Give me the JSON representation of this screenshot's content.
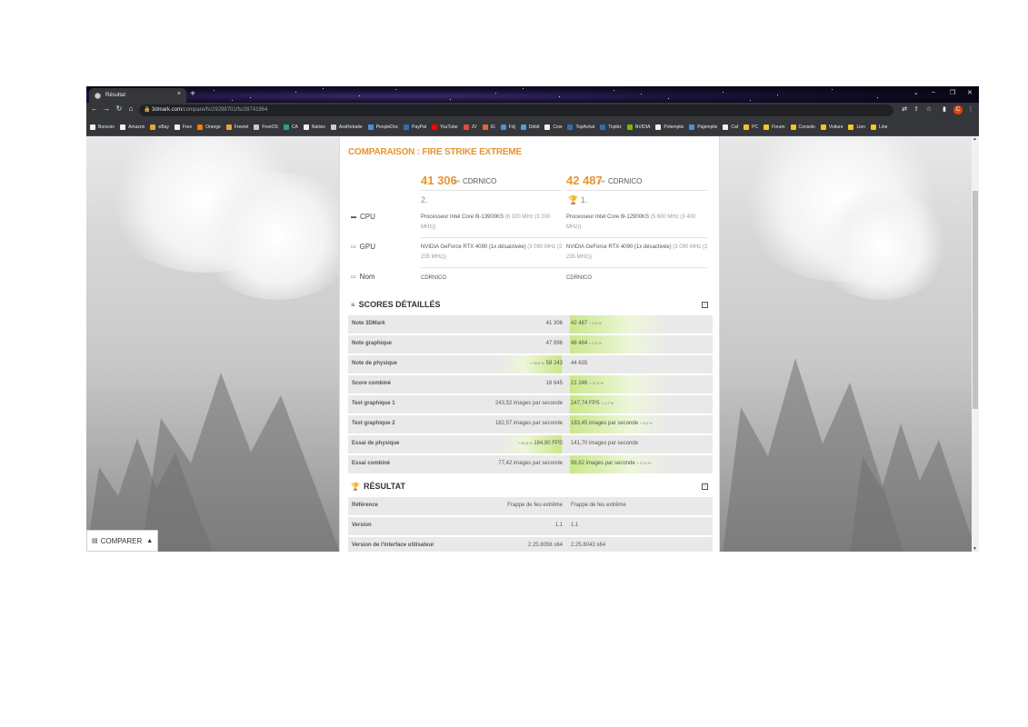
{
  "browser": {
    "tab_title": "Résultat",
    "tab_close": "×",
    "new_tab": "+",
    "url_host": "3dmark.com",
    "url_path": "/compare/fs/29298701/fs/28741964",
    "window_controls": [
      "⌄",
      "–",
      "❐",
      "✕"
    ]
  },
  "bookmarks": [
    {
      "label": "Boncoin",
      "color": "#f0f0f0"
    },
    {
      "label": "Amazon",
      "color": "#f0f0f0"
    },
    {
      "label": "eBay",
      "color": "#e8a33a"
    },
    {
      "label": "Free",
      "color": "#f0f0f0"
    },
    {
      "label": "Orange",
      "color": "#ff7900"
    },
    {
      "label": "Freetel",
      "color": "#e8a33a"
    },
    {
      "label": "FreeOS",
      "color": "#cccccc"
    },
    {
      "label": "CA",
      "color": "#2e9e8f"
    },
    {
      "label": "Natixis",
      "color": "#f0f0f0"
    },
    {
      "label": "AssRetraite",
      "color": "#cccccc"
    },
    {
      "label": "PeopleDoc",
      "color": "#4a90d9"
    },
    {
      "label": "PayPal",
      "color": "#2c6fb5"
    },
    {
      "label": "YouTube",
      "color": "#ff0000"
    },
    {
      "label": "JV",
      "color": "#e84b3c"
    },
    {
      "label": "IG",
      "color": "#e8652e"
    },
    {
      "label": "Fdj",
      "color": "#4a90d9"
    },
    {
      "label": "Débit",
      "color": "#4aa3df"
    },
    {
      "label": "Cow",
      "color": "#f0f0f0"
    },
    {
      "label": "TopAchat",
      "color": "#2c6fb5"
    },
    {
      "label": "Topbiz",
      "color": "#2c6fb5"
    },
    {
      "label": "NVIDIA",
      "color": "#76b900"
    },
    {
      "label": "Polemploi",
      "color": "#f0f0f0"
    },
    {
      "label": "Pajemploi",
      "color": "#4a90d9"
    },
    {
      "label": "Caf",
      "color": "#f0f0f0"
    },
    {
      "label": "PC",
      "color": "#f3c623"
    },
    {
      "label": "Forum",
      "color": "#f3c623"
    },
    {
      "label": "Console",
      "color": "#f3c623"
    },
    {
      "label": "Voiture",
      "color": "#f3c623"
    },
    {
      "label": "Lien",
      "color": "#f3c623"
    },
    {
      "label": "Line",
      "color": "#f3c623"
    }
  ],
  "page": {
    "title": "COMPARAISON : FIRE STRIKE EXTREME",
    "left": {
      "score": "41 306",
      "par": "par",
      "user": "CDRNICO",
      "rank": "2."
    },
    "right": {
      "score": "42 487",
      "par": "par",
      "user": "CDRNICO",
      "rank": "1."
    },
    "hardware": {
      "cpu_label": "CPU",
      "gpu_label": "GPU",
      "name_label": "Nom",
      "left_cpu": "Processeur Intel Core i9-13900KS",
      "left_cpu_clock": "(6 100 MHz (3 200 MHz))",
      "right_cpu": "Processeur Intel Core i9-12900KS",
      "right_cpu_clock": "(5 600 MHz (3 400 MHz))",
      "left_gpu": "NVIDIA GeForce RTX 4090 (1x désactivée)",
      "left_gpu_clock": "(3 090 MHz (2 235 MHz))",
      "right_gpu": "NVIDIA GeForce RTX 4090 (1x désactivée)",
      "right_gpu_clock": "(3 090 MHz (2 235 MHz))",
      "left_name": "CDRNICO",
      "right_name": "CDRNICO"
    },
    "scores_heading": "SCORES DÉTAILLÉS",
    "scores": [
      {
        "label": "Note 3DMark",
        "left": "41 306",
        "right": "42 487",
        "right_pct": "+ 2,9 %",
        "winner": "right"
      },
      {
        "label": "Note graphique",
        "left": "47 996",
        "right": "48 484",
        "right_pct": "+ 1,0 %",
        "winner": "right"
      },
      {
        "label": "Note de physique",
        "left": "58 243",
        "left_pct": "+ 30,5 %",
        "right": "44 635",
        "winner": "left"
      },
      {
        "label": "Score combiné",
        "left": "16 645",
        "right": "21 246",
        "right_pct": "+ 27,6 %",
        "winner": "right"
      },
      {
        "label": "Test graphique 1",
        "left": "243,52 images par seconde",
        "right": "247,74 FPS",
        "right_pct": "+ 1,7 %",
        "winner": "right"
      },
      {
        "label": "Test graphique 2",
        "left": "182,57 images par seconde",
        "right": "183,45 images par seconde",
        "right_pct": "+ 0,5 %",
        "winner": "right"
      },
      {
        "label": "Essai de physique",
        "left": "184,90 FPS",
        "left_pct": "+ 30,5 %",
        "right": "141,70 images par seconde",
        "winner": "left"
      },
      {
        "label": "Essai combiné",
        "left": "77,42 images par seconde",
        "right": "98,82 images par seconde",
        "right_pct": "+ 27,6 %",
        "winner": "right"
      }
    ],
    "result_heading": "RÉSULTAT",
    "result_rows": [
      {
        "label": "Référence",
        "left": "Frappe de feu extrême",
        "right": "Frappe de feu extrême"
      },
      {
        "label": "Version",
        "left": "1.1",
        "right": "1.1"
      },
      {
        "label": "Version de l'interface utilisateur",
        "left": "2.25.8056 s64",
        "right": "2.25.8043 s64"
      }
    ],
    "compare_button": "COMPARER"
  }
}
